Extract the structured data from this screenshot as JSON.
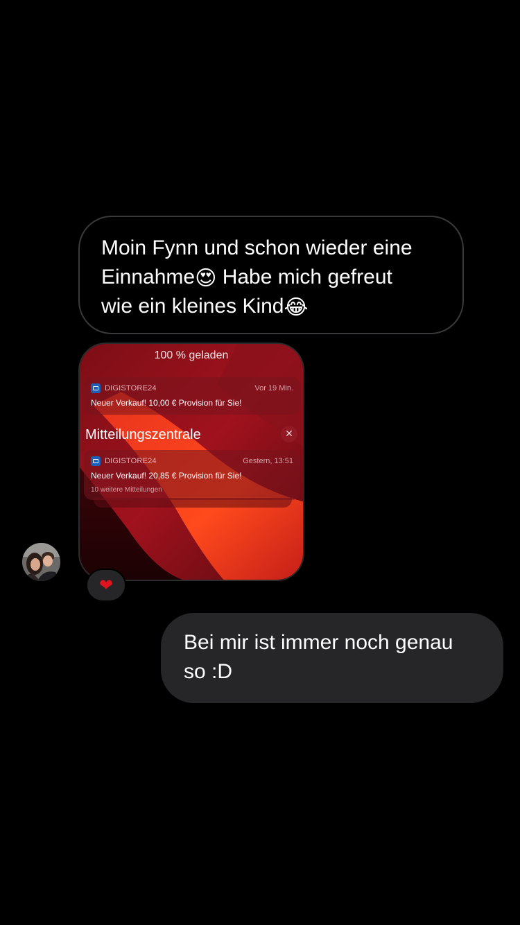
{
  "thread": {
    "incoming_text": {
      "line1": "Moin Fynn und schon wieder eine",
      "line2a": "Einnahme",
      "emoji1": "😍",
      "line2b": " Habe mich gefreut",
      "line3a": "wie ein kleines Kind",
      "emoji2": "😂"
    },
    "image_message": {
      "charge_status": "100 % geladen",
      "notification_1": {
        "app": "DIGISTORE24",
        "time": "Vor 19 Min.",
        "text": "Neuer Verkauf! 10,00 € Provision für Sie!"
      },
      "center_title": "Mitteilungszentrale",
      "close_glyph": "✕",
      "notification_2": {
        "app": "DIGISTORE24",
        "time": "Gestern, 13:51",
        "text": "Neuer Verkauf! 20,85 € Provision für Sie!",
        "more": "10 weitere Mitteilungen"
      }
    },
    "reaction": {
      "glyph": "❤"
    },
    "outgoing_text": {
      "line1": "Bei mir ist immer noch genau",
      "line2": "so :D"
    }
  },
  "colors": {
    "background": "#000000",
    "outgoing_bubble": "#262628",
    "incoming_border": "#3a3a3c",
    "heart": "#e0141e"
  }
}
